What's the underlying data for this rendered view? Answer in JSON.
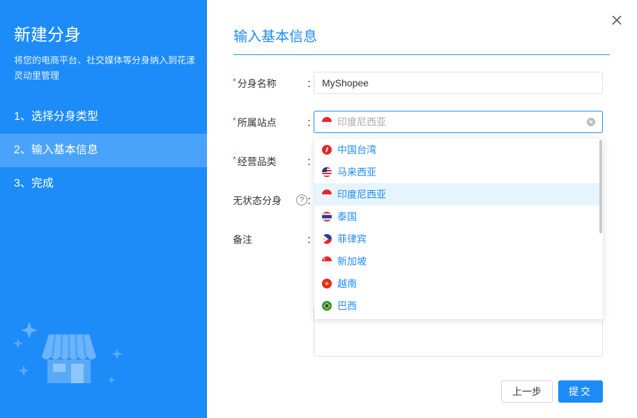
{
  "sidebar": {
    "title": "新建分身",
    "description": "将您的电商平台、社交媒体等分身纳入到花漾灵动里管理",
    "steps": [
      {
        "label": "1、选择分身类型"
      },
      {
        "label": "2、输入基本信息"
      },
      {
        "label": "3、完成"
      }
    ]
  },
  "header": {
    "title": "输入基本信息",
    "close_icon": "close-icon"
  },
  "form": {
    "name": {
      "label": "分身名称",
      "value": "MyShopee"
    },
    "site": {
      "label": "所属站点",
      "selected": "印度尼西亚"
    },
    "category": {
      "label": "经营品类"
    },
    "stateless": {
      "label": "无状态分身",
      "help": "?"
    },
    "remark": {
      "label": "备注"
    },
    "colon": "："
  },
  "dropdown": {
    "options": [
      {
        "label": "中国台湾",
        "flag": "taiwan-flag-icon"
      },
      {
        "label": "马来西亚",
        "flag": "malaysia-flag-icon"
      },
      {
        "label": "印度尼西亚",
        "flag": "indonesia-flag-icon"
      },
      {
        "label": "泰国",
        "flag": "thailand-flag-icon"
      },
      {
        "label": "菲律宾",
        "flag": "philippines-flag-icon"
      },
      {
        "label": "新加坡",
        "flag": "singapore-flag-icon"
      },
      {
        "label": "越南",
        "flag": "vietnam-flag-icon"
      },
      {
        "label": "巴西",
        "flag": "brazil-flag-icon"
      }
    ]
  },
  "footer": {
    "prev_label": "上一步",
    "submit_label": "提交"
  },
  "colors": {
    "accent": "#1d8cf8",
    "sidebar_active": "#4aa3fb",
    "required": "#e03030",
    "selected_option_bg": "#e6f4fd"
  }
}
